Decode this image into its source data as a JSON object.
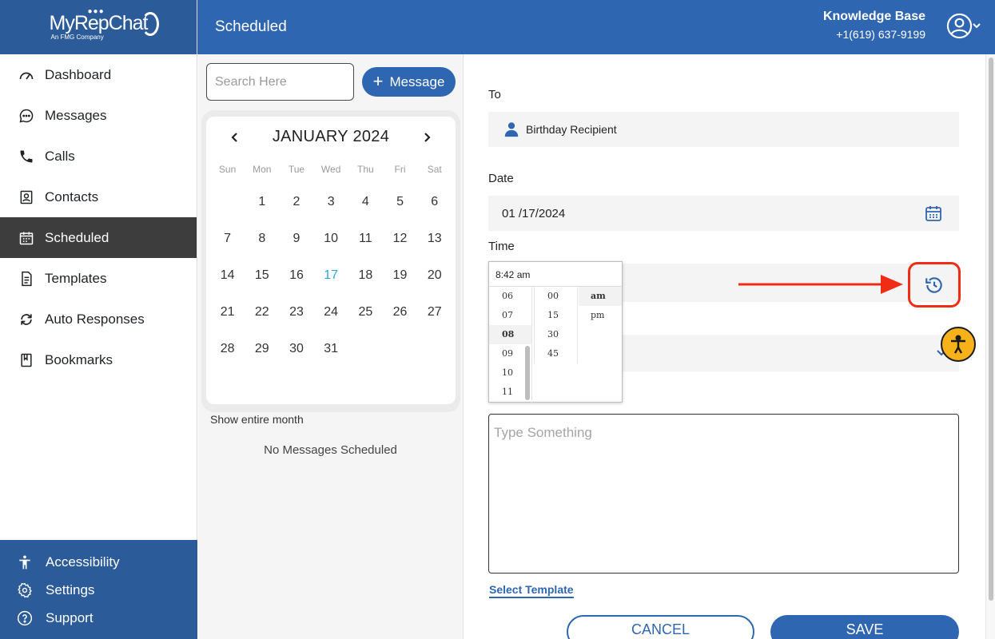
{
  "app": {
    "logo_text": "MyRepChat",
    "logo_sub": "An FMG Company"
  },
  "sidebar": {
    "items": [
      {
        "label": "Dashboard",
        "icon": "gauge-icon"
      },
      {
        "label": "Messages",
        "icon": "chat-bubble-icon"
      },
      {
        "label": "Calls",
        "icon": "phone-icon"
      },
      {
        "label": "Contacts",
        "icon": "contact-card-icon"
      },
      {
        "label": "Scheduled",
        "icon": "calendar-icon",
        "active": true
      },
      {
        "label": "Templates",
        "icon": "document-icon"
      },
      {
        "label": "Auto Responses",
        "icon": "refresh-icon"
      },
      {
        "label": "Bookmarks",
        "icon": "book-icon"
      }
    ],
    "bottom": [
      {
        "label": "Accessibility",
        "icon": "accessibility-icon"
      },
      {
        "label": "Settings",
        "icon": "gear-icon"
      },
      {
        "label": "Support",
        "icon": "question-icon"
      }
    ]
  },
  "header": {
    "title": "Scheduled",
    "account_name": "Knowledge Base",
    "account_phone": "+1(619) 637-9199"
  },
  "middle": {
    "search_placeholder": "Search Here",
    "message_button": "Message",
    "calendar": {
      "month_label": "JANUARY 2024",
      "weekdays": [
        "Sun",
        "Mon",
        "Tue",
        "Wed",
        "Thu",
        "Fri",
        "Sat"
      ],
      "days": [
        "",
        "1",
        "2",
        "3",
        "4",
        "5",
        "6",
        "7",
        "8",
        "9",
        "10",
        "11",
        "12",
        "13",
        "14",
        "15",
        "16",
        "17",
        "18",
        "19",
        "20",
        "21",
        "22",
        "23",
        "24",
        "25",
        "26",
        "27",
        "28",
        "29",
        "30",
        "31"
      ],
      "today": "17"
    },
    "show_month": "Show entire month",
    "empty_state": "No Messages Scheduled"
  },
  "form": {
    "to_label": "To",
    "recipient": "Birthday Recipient",
    "date_label": "Date",
    "date_value": "01 /17/2024",
    "time_label": "Time",
    "message_placeholder": "Type Something",
    "select_template": "Select Template",
    "cancel": "CANCEL",
    "save": "SAVE",
    "highlight_color": "#f02d14"
  },
  "time_picker": {
    "input_value": "8:42 am",
    "hours": [
      "06",
      "07",
      "08",
      "09",
      "10",
      "11"
    ],
    "selected_hour": "08",
    "minutes": [
      "00",
      "15",
      "30",
      "45"
    ],
    "ampm": [
      "am",
      "pm"
    ],
    "selected_ampm": "am"
  },
  "colors": {
    "brand_blue": "#2f66b1",
    "sidebar_active": "#3d3d3d",
    "accent_today": "#2aa8e0"
  }
}
